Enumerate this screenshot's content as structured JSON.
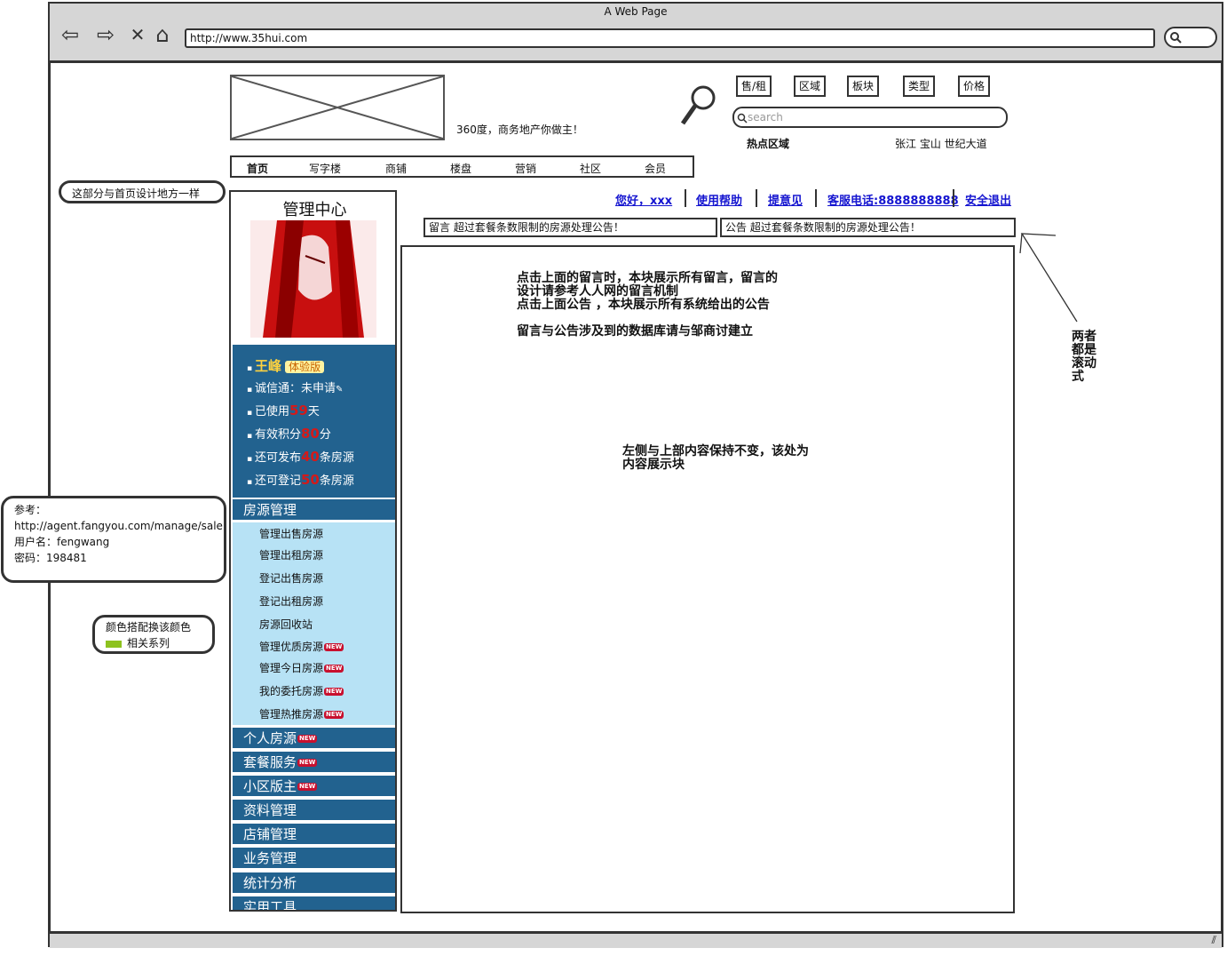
{
  "browser": {
    "title": "A Web Page",
    "url": "http://www.35hui.com"
  },
  "header": {
    "slogan": "360度，商务地产你做主！",
    "filters": [
      "售/租",
      "区域",
      "板块",
      "类型",
      "价格"
    ],
    "search_placeholder": "search",
    "hot_label": "热点区域",
    "hot_areas": "张江  宝山  世纪大道"
  },
  "main_nav": [
    "首页",
    "写字楼",
    "商铺",
    "楼盘",
    "营销",
    "社区",
    "会员"
  ],
  "annotations": {
    "header_note": "这部分与首页设计地方一样",
    "reference": {
      "label": "参考：",
      "url": "http://agent.fangyou.com/manage/sale",
      "username": "用户名：fengwang",
      "password": "密码：198481"
    },
    "color_note": {
      "line1": "颜色搭配换该颜色",
      "line2": "相关系列",
      "swatch_color": "#8dc21f"
    },
    "scroll_note": "两者都是滚动式"
  },
  "sidebar": {
    "title": "管理中心",
    "user": {
      "name": "王峰",
      "badge": "体验版",
      "cert_label": "诚信通：",
      "cert_value": "未申请",
      "used_prefix": "已使用",
      "used_days": "59",
      "used_suffix": "天",
      "points_prefix": "有效积分",
      "points": "80",
      "points_suffix": "分",
      "publish_prefix": "还可发布",
      "publish_count": "40",
      "publish_suffix": "条房源",
      "register_prefix": "还可登记",
      "register_count": "50",
      "register_suffix": "条房源"
    },
    "house_mgmt": "房源管理",
    "sub_items": [
      "管理出售房源",
      "管理出租房源",
      "登记出售房源",
      "登记出租房源",
      "房源回收站",
      "管理优质房源",
      "管理今日房源",
      "我的委托房源",
      "管理热推房源"
    ],
    "new_badge": "NEW",
    "sections": [
      "个人房源",
      "套餐服务",
      "小区版主",
      "资料管理",
      "店铺管理",
      "业务管理",
      "统计分析",
      "实用工具"
    ]
  },
  "top_links": [
    "您好，xxx",
    "使用帮助",
    "提意见",
    "客服电话:8888888888",
    "安全退出"
  ],
  "notices": {
    "left": "留言  超过套餐条数限制的房源处理公告！",
    "right": "公告  超过套餐条数限制的房源处理公告！"
  },
  "content_notes": {
    "line1": "点击上面的留言时，本块展示所有留言，留言的",
    "line2": "设计请参考人人网的留言机制",
    "line3": "点击上面公告 ，本块展示所有系统给出的公告",
    "line4": "留言与公告涉及到的数据库请与邹商讨建立",
    "line5": "左侧与上部内容保持不变，该处为",
    "line6": "内容展示块"
  },
  "colors": {
    "sidebar_blue": "#22628f",
    "submenu_light": "#b7e2f5",
    "link_blue": "#1515d0",
    "highlight_red": "#d41a1a"
  }
}
